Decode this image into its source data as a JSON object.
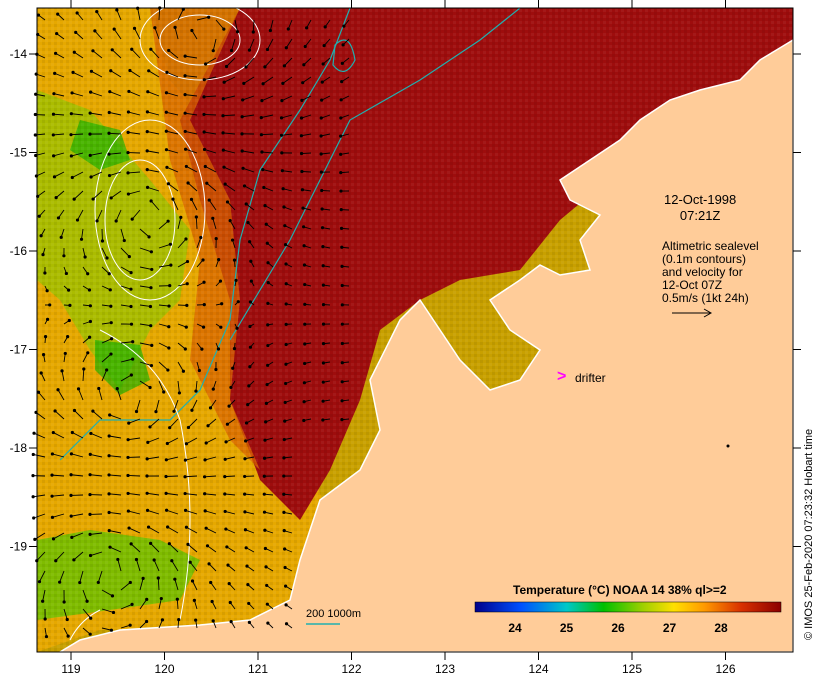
{
  "map": {
    "x_axis": {
      "ticks": [
        "119",
        "120",
        "121",
        "122",
        "123",
        "124",
        "125",
        "126"
      ]
    },
    "y_axis": {
      "ticks": [
        "-14",
        "-15",
        "-16",
        "-17",
        "-18",
        "-19"
      ]
    },
    "colors": {
      "land": "#ffcc99",
      "warm_sea": "#9e0d0d",
      "coast": "#ffffff",
      "contour": "#ffffff",
      "isobath": "#20b0b0",
      "arrow": "#000000"
    }
  },
  "annotations": {
    "date": "12-Oct-1998",
    "time": "07:21Z",
    "legend_lines": [
      "Altimetric sealevel",
      "(0.1m contours)",
      "and velocity for",
      "12-Oct 07Z",
      "0.5m/s (1kt 24h)"
    ],
    "drifter": "drifter"
  },
  "colorbar": {
    "title": "Temperature (°C) NOAA 14 38% ql>=2",
    "ticks": [
      "24",
      "25",
      "26",
      "27",
      "28"
    ]
  },
  "depth_scale": "200  1000m",
  "credit": "© IMOS 25-Feb-2020 07:23:32 Hobart time"
}
